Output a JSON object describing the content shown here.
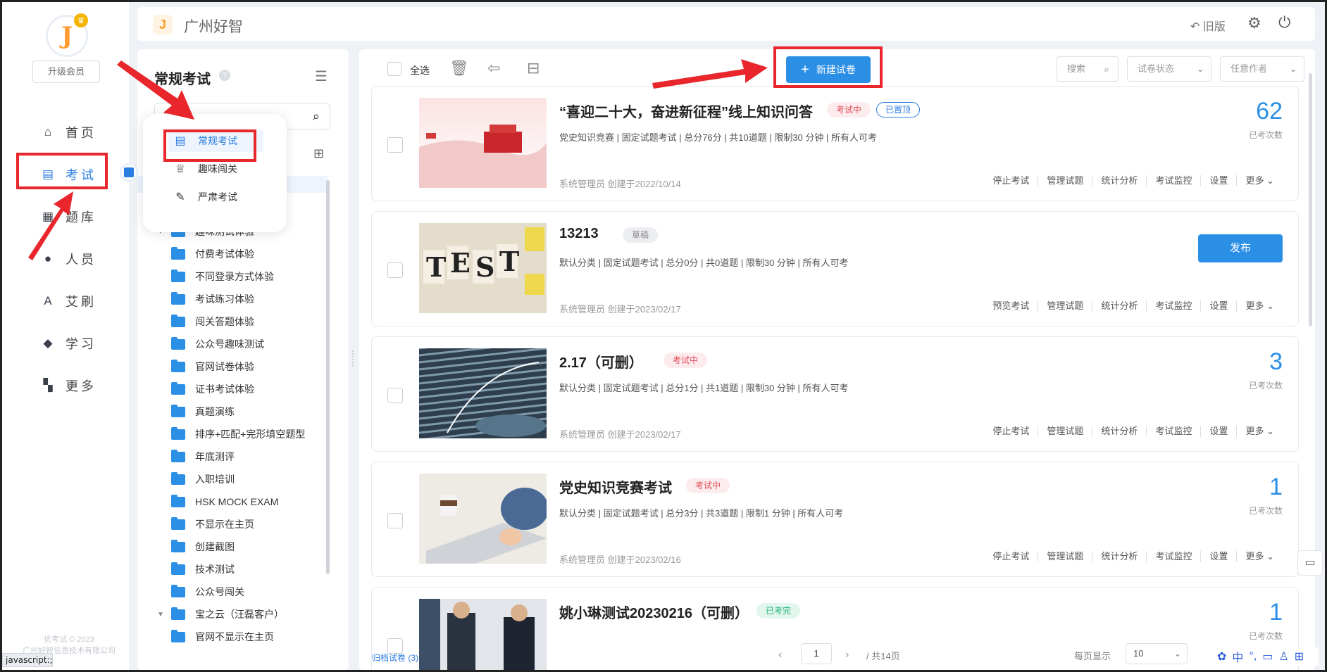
{
  "nav": {
    "upgrade": "升级会员",
    "items": [
      {
        "label": "首页",
        "icon": "home-icon",
        "glyph": "⌂"
      },
      {
        "label": "考试",
        "icon": "exam-icon",
        "glyph": "▤"
      },
      {
        "label": "题库",
        "icon": "question-bank-icon",
        "glyph": "▦"
      },
      {
        "label": "人员",
        "icon": "person-icon",
        "glyph": "●"
      },
      {
        "label": "艾刷",
        "icon": "font-a-icon",
        "glyph": "A"
      },
      {
        "label": "学习",
        "icon": "graduation-cap-icon",
        "glyph": "◆"
      },
      {
        "label": "更多",
        "icon": "grid-icon",
        "glyph": "▚"
      }
    ],
    "copyright_line1": "优考试 © 2023",
    "copyright_line2": "广州好智信息技术有限公司"
  },
  "statusbar": "javascript:;",
  "header": {
    "brand": "广州好智",
    "old_version": "旧版"
  },
  "category": {
    "title": "常规考试",
    "search_placeholder": "搜索",
    "tree": [
      {
        "label": "趣味测试体验",
        "caret": true
      },
      {
        "label": "付费考试体验"
      },
      {
        "label": "不同登录方式体验"
      },
      {
        "label": "考试练习体验"
      },
      {
        "label": "闯关答题体验"
      },
      {
        "label": "公众号趣味测试"
      },
      {
        "label": "官网试卷体验"
      },
      {
        "label": "证书考试体验"
      },
      {
        "label": "真题演练"
      },
      {
        "label": "排序+匹配+完形填空题型"
      },
      {
        "label": "年底测评"
      },
      {
        "label": "入职培训"
      },
      {
        "label": "HSK MOCK EXAM"
      },
      {
        "label": "不显示在主页"
      },
      {
        "label": "创建截图"
      },
      {
        "label": "技术测试"
      },
      {
        "label": "公众号闯关"
      },
      {
        "label": "宝之云（汪磊客户）",
        "caret": true
      },
      {
        "label": "官网不显示在主页"
      }
    ]
  },
  "popup": {
    "items": [
      {
        "label": "常规考试",
        "icon": "document-icon",
        "glyph": "▤",
        "active": true
      },
      {
        "label": "趣味闯关",
        "icon": "trophy-icon",
        "glyph": "♕"
      },
      {
        "label": "严肃考试",
        "icon": "exam-pen-icon",
        "glyph": "✎"
      }
    ]
  },
  "toolbar": {
    "select_all": "全选",
    "new_exam": "新建试卷",
    "search_placeholder": "搜索",
    "status_filter": "试卷状态",
    "author_filter": "任意作者"
  },
  "cards": [
    {
      "title": "“喜迎二十大，奋进新征程”线上知识问答",
      "tags": [
        {
          "text": "考试中",
          "kind": "red"
        },
        {
          "text": "已置顶",
          "kind": "blue"
        }
      ],
      "meta": "党史知识竞赛 | 固定试题考试 | 总分76分 | 共10道题 | 限制30 分钟 | 所有人可考",
      "creator": "系统管理员 创建于2022/10/14",
      "actions": [
        "停止考试",
        "管理试题",
        "统计分析",
        "考试监控",
        "设置",
        "更多 ⌄"
      ],
      "count": "62",
      "count_label": "已考次数"
    },
    {
      "title": "13213",
      "tags": [
        {
          "text": "草稿",
          "kind": "gray"
        }
      ],
      "meta": "默认分类 | 固定试题考试 | 总分0分 | 共0道题 | 限制30 分钟 | 所有人可考",
      "creator": "系统管理员 创建于2023/02/17",
      "actions": [
        "预览考试",
        "管理试题",
        "统计分析",
        "考试监控",
        "设置",
        "更多 ⌄"
      ],
      "publish": "发布"
    },
    {
      "title": "2.17（可删）",
      "tags": [
        {
          "text": "考试中",
          "kind": "red"
        }
      ],
      "meta": "默认分类 | 固定试题考试 | 总分1分 | 共1道题 | 限制30 分钟 | 所有人可考",
      "creator": "系统管理员 创建于2023/02/17",
      "actions": [
        "停止考试",
        "管理试题",
        "统计分析",
        "考试监控",
        "设置",
        "更多 ⌄"
      ],
      "count": "3",
      "count_label": "已考次数"
    },
    {
      "title": "党史知识竞赛考试",
      "tags": [
        {
          "text": "考试中",
          "kind": "red"
        }
      ],
      "meta": "默认分类 | 固定试题考试 | 总分3分 | 共3道题 | 限制1 分钟 | 所有人可考",
      "creator": "系统管理员 创建于2023/02/16",
      "actions": [
        "停止考试",
        "管理试题",
        "统计分析",
        "考试监控",
        "设置",
        "更多 ⌄"
      ],
      "count": "1",
      "count_label": "已考次数"
    },
    {
      "title": "姚小琳测试20230216（可删）",
      "tags": [
        {
          "text": "已考完",
          "kind": "green"
        }
      ],
      "meta": "",
      "creator": "",
      "actions": [],
      "count": "1",
      "count_label": "已考次数"
    }
  ],
  "pager": {
    "archive": "归档试卷 (3)",
    "page": "1",
    "total": "/ 共14页",
    "per_page_label": "每页显示",
    "per_page": "10"
  },
  "colors": {
    "accent": "#2b8fe6",
    "annotation_red": "#e8262b"
  }
}
